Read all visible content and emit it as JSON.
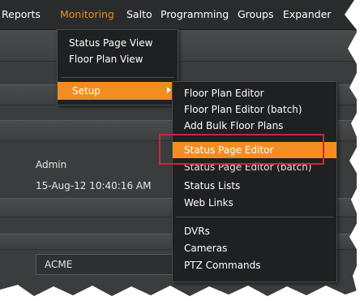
{
  "menubar": {
    "items": [
      "Reports",
      "Monitoring",
      "Salto",
      "Programming",
      "Groups",
      "Expander"
    ],
    "active_color": "#f08c1e"
  },
  "monitoring_menu": {
    "items": [
      "Status Page View",
      "Floor Plan View"
    ],
    "setup_label": "Setup"
  },
  "setup_submenu": {
    "group1": [
      "Floor Plan Editor",
      "Floor Plan Editor (batch)",
      "Add Bulk Floor Plans",
      "Status Page Editor",
      "Status Page Editor (batch)",
      "Status Lists",
      "Web Links"
    ],
    "group2": [
      "DVRs",
      "Cameras",
      "PTZ Commands"
    ],
    "highlighted": "Status Page Editor"
  },
  "background": {
    "user": "Admin",
    "datetime": "15-Aug-12 10:40:16 AM",
    "company": "ACME"
  },
  "colors": {
    "highlight": "#f28d22",
    "callout_border": "#c6283a",
    "menu_bg": "#1f2021"
  }
}
